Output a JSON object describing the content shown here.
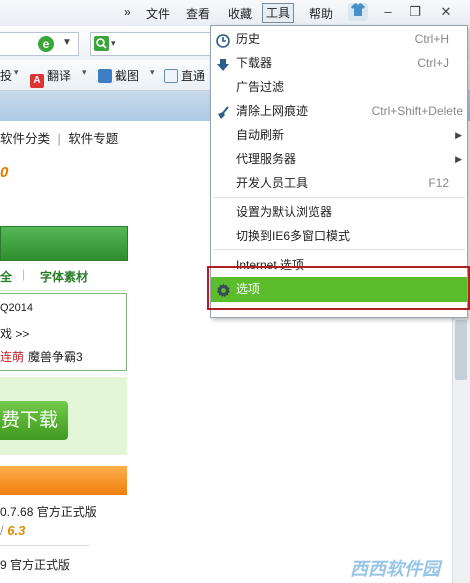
{
  "menubar": {
    "chevron": "»",
    "items": [
      "文件",
      "查看",
      "收藏",
      "工具",
      "帮助"
    ],
    "active_index": 3
  },
  "toolbar": {
    "translate": "翻译",
    "screenshot": "截图",
    "direct": "直通",
    "partial_left": "投"
  },
  "page": {
    "nav_partial": "软件分类",
    "nav_topic": "软件专题",
    "orange_text": "0",
    "cat_left": "全",
    "cat_font": "字体素材",
    "item1": "Q2014",
    "item2": "戏  >>",
    "item3_red": "连萌",
    "item3": "魔兽争霸3",
    "download_btn": "费下载",
    "version1": "0.7.68 官方正式版",
    "score1_prefix": "/",
    "score1": "6.3",
    "version2": "9 官方正式版"
  },
  "tools_menu": {
    "items": [
      {
        "label": "历史",
        "shortcut": "Ctrl+H",
        "icon": "history-icon"
      },
      {
        "label": "下载器",
        "shortcut": "Ctrl+J",
        "icon": "download-icon"
      },
      {
        "label": "广告过滤",
        "shortcut": "",
        "icon": ""
      },
      {
        "label": "清除上网痕迹",
        "shortcut": "Ctrl+Shift+Delete",
        "icon": "broom-icon"
      },
      {
        "label": "自动刷新",
        "shortcut": "",
        "submenu": true
      },
      {
        "label": "代理服务器",
        "shortcut": "",
        "submenu": true
      },
      {
        "label": "开发人员工具",
        "shortcut": "F12"
      },
      {
        "label": "设置为默认浏览器",
        "shortcut": ""
      },
      {
        "label": "切换到IE6多窗口模式",
        "shortcut": ""
      },
      {
        "label": "Internet 选项",
        "shortcut": ""
      },
      {
        "label": "选项",
        "shortcut": "",
        "icon": "gear-icon",
        "selected": true
      }
    ]
  },
  "watermark": "西西软件园",
  "colors": {
    "selected": "#5cbd2c",
    "highlight_frame": "#b11f24"
  }
}
